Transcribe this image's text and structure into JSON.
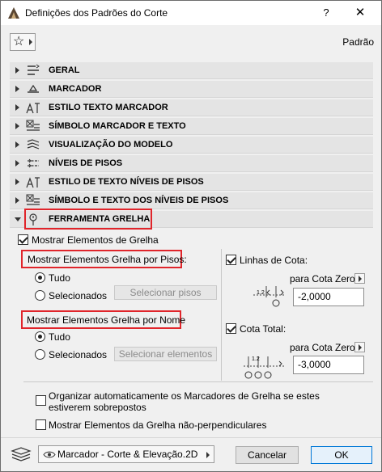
{
  "window": {
    "title": "Definições dos Padrões do Corte",
    "help_label": "?",
    "close_label": "✕"
  },
  "toolbar": {
    "favorites_icon": "star-icon",
    "preset_label": "Padrão"
  },
  "panels": [
    {
      "label": "GERAL",
      "icon": "general-settings-icon"
    },
    {
      "label": "MARCADOR",
      "icon": "marker-icon"
    },
    {
      "label": "ESTILO TEXTO MARCADOR",
      "icon": "text-style-icon"
    },
    {
      "label": "SÍMBOLO MARCADOR E TEXTO",
      "icon": "symbol-text-icon"
    },
    {
      "label": "VISUALIZAÇÃO DO MODELO",
      "icon": "model-view-icon"
    },
    {
      "label": "NÍVEIS DE PISOS",
      "icon": "story-levels-icon"
    },
    {
      "label": "ESTILO DE TEXTO NÍVEIS DE PISOS",
      "icon": "text-style-icon"
    },
    {
      "label": "SÍMBOLO E TEXTO DOS NÍVEIS DE PISOS",
      "icon": "symbol-text-icon"
    },
    {
      "label": "FERRAMENTA GRELHA",
      "icon": "grid-tool-icon"
    }
  ],
  "grid": {
    "show_elements_label": "Mostrar Elementos de Grelha",
    "by_story_title": "Mostrar Elementos Grelha por Pisos:",
    "all_label": "Tudo",
    "selected_label": "Selecionados",
    "select_stories_button": "Selecionar pisos",
    "by_name_title": "Mostrar Elementos Grelha por Nome",
    "select_elements_button": "Selecionar elementos",
    "dimension_lines_label": "Linhas de Cota:",
    "zero_dimension_label": "para Cota Zero",
    "dimension_lines_value": "-2,0000",
    "total_dimension_label": "Cota Total:",
    "total_dimension_value": "-3,0000",
    "diagram_text_1": "1.2",
    "diagram_text_2": "1.2",
    "auto_arrange_label": "Organizar automaticamente os Marcadores de Grelha se estes estiverem sobrepostos",
    "non_perpendicular_label": "Mostrar Elementos da Grelha não-perpendiculares"
  },
  "footer": {
    "view_dropdown": "Marcador - Corte & Elevação.2D",
    "cancel_label": "Cancelar",
    "ok_label": "OK"
  }
}
